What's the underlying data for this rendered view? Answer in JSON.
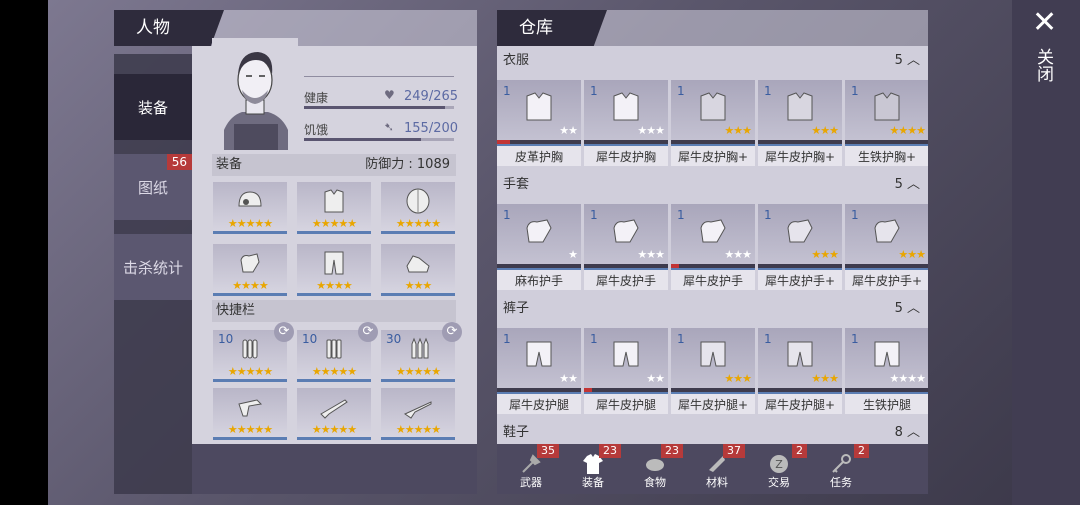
{
  "character_panel": {
    "title": "人物",
    "tabs": [
      {
        "label": "装备",
        "badge": ""
      },
      {
        "label": "图纸",
        "badge": "56"
      },
      {
        "label": "击杀统计",
        "badge": ""
      }
    ],
    "stats": {
      "health_label": "健康",
      "health_value": "249/265",
      "health_ratio": 0.94,
      "hunger_label": "饥饿",
      "hunger_value": "155/200",
      "hunger_ratio": 0.78
    },
    "equipment_label": "装备",
    "defense_label": "防御力 : 1089",
    "equipment": [
      {
        "icon": "helmet-icon",
        "stars": "★★★★★"
      },
      {
        "icon": "armor-icon",
        "stars": "★★★★★"
      },
      {
        "icon": "shield-icon",
        "stars": "★★★★★"
      },
      {
        "icon": "gloves-icon",
        "stars": "★★★★"
      },
      {
        "icon": "pants-icon",
        "stars": "★★★★"
      },
      {
        "icon": "shoes-icon",
        "stars": "★★★"
      }
    ],
    "quickbar_label": "快捷栏",
    "quickbar": [
      {
        "icon": "ammo-icon",
        "count": "10",
        "stars": "★★★★★"
      },
      {
        "icon": "ammo-icon",
        "count": "10",
        "stars": "★★★★★"
      },
      {
        "icon": "bullet-icon",
        "count": "30",
        "stars": "★★★★★"
      },
      {
        "icon": "revolver-icon",
        "count": "",
        "stars": "★★★★★"
      },
      {
        "icon": "shotgun-icon",
        "count": "",
        "stars": "★★★★★"
      },
      {
        "icon": "rifle-icon",
        "count": "",
        "stars": "★★★★★"
      }
    ]
  },
  "warehouse": {
    "title": "仓库",
    "categories": [
      {
        "name": "衣服",
        "count": "5",
        "items": [
          {
            "count": "1",
            "name": "皮革护胸",
            "stars": "★★",
            "star_style": "white",
            "durability": 0.15
          },
          {
            "count": "1",
            "name": "犀牛皮护胸",
            "stars": "★★★",
            "star_style": "white",
            "durability": 0
          },
          {
            "count": "1",
            "name": "犀牛皮护胸+",
            "stars": "★★★",
            "star_style": "gold",
            "durability": 0
          },
          {
            "count": "1",
            "name": "犀牛皮护胸+",
            "stars": "★★★",
            "star_style": "gold",
            "durability": 0
          },
          {
            "count": "1",
            "name": "生铁护胸+",
            "stars": "★★★★",
            "star_style": "gold",
            "durability": 0
          }
        ]
      },
      {
        "name": "手套",
        "count": "5",
        "items": [
          {
            "count": "1",
            "name": "麻布护手",
            "stars": "★",
            "star_style": "white",
            "durability": 0
          },
          {
            "count": "1",
            "name": "犀牛皮护手",
            "stars": "★★★",
            "star_style": "white",
            "durability": 0
          },
          {
            "count": "1",
            "name": "犀牛皮护手",
            "stars": "★★★",
            "star_style": "white",
            "durability": 0.1
          },
          {
            "count": "1",
            "name": "犀牛皮护手+",
            "stars": "★★★",
            "star_style": "gold",
            "durability": 0
          },
          {
            "count": "1",
            "name": "犀牛皮护手+",
            "stars": "★★★",
            "star_style": "gold",
            "durability": 0
          }
        ]
      },
      {
        "name": "裤子",
        "count": "5",
        "items": [
          {
            "count": "1",
            "name": "犀牛皮护腿",
            "stars": "★★",
            "star_style": "white",
            "durability": 0
          },
          {
            "count": "1",
            "name": "犀牛皮护腿",
            "stars": "★★",
            "star_style": "white",
            "durability": 0.1
          },
          {
            "count": "1",
            "name": "犀牛皮护腿+",
            "stars": "★★★",
            "star_style": "gold",
            "durability": 0
          },
          {
            "count": "1",
            "name": "犀牛皮护腿+",
            "stars": "★★★",
            "star_style": "gold",
            "durability": 0
          },
          {
            "count": "1",
            "name": "生铁护腿",
            "stars": "★★★★",
            "star_style": "white",
            "durability": 0
          }
        ]
      },
      {
        "name": "鞋子",
        "count": "8",
        "items": []
      }
    ],
    "tabs": [
      {
        "label": "武器",
        "badge": "35",
        "icon": "axe-icon"
      },
      {
        "label": "装备",
        "badge": "23",
        "icon": "shirt-icon"
      },
      {
        "label": "食物",
        "badge": "23",
        "icon": "food-icon"
      },
      {
        "label": "材料",
        "badge": "37",
        "icon": "material-icon"
      },
      {
        "label": "交易",
        "badge": "2",
        "icon": "coin-icon"
      },
      {
        "label": "任务",
        "badge": "2",
        "icon": "key-icon"
      }
    ],
    "selected_tab": "装备"
  },
  "close": {
    "label": "关闭"
  },
  "colors": {
    "accent_blue": "#5b7db3",
    "badge_red": "#b63a3a",
    "star_gold": "#e9a600"
  }
}
